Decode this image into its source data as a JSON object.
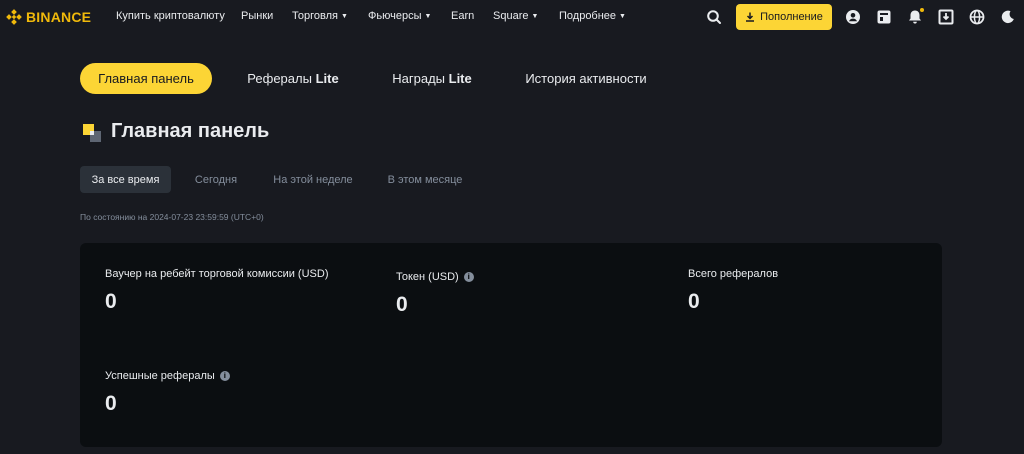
{
  "header": {
    "logo_text": "BINANCE",
    "nav": [
      {
        "label": "Купить криптовалюту",
        "dropdown": false
      },
      {
        "label": "Рынки",
        "dropdown": false
      },
      {
        "label": "Торговля",
        "dropdown": true
      },
      {
        "label": "Фьючерсы",
        "dropdown": true
      },
      {
        "label": "Earn",
        "dropdown": false
      },
      {
        "label": "Square",
        "dropdown": true
      },
      {
        "label": "Подробнее",
        "dropdown": true
      }
    ],
    "deposit_label": "Пополнение",
    "icons": [
      "search-icon",
      "user-icon",
      "orders-icon",
      "bell-icon",
      "download-icon",
      "globe-icon",
      "moon-icon"
    ],
    "accent": "#fcd535"
  },
  "tabs": [
    {
      "label": "Главная панель",
      "suffix": "",
      "active": true
    },
    {
      "label": "Рефералы",
      "suffix": "Lite",
      "active": false
    },
    {
      "label": "Награды",
      "suffix": "Lite",
      "active": false
    },
    {
      "label": "История активности",
      "suffix": "",
      "active": false
    }
  ],
  "page_title": "Главная панель",
  "periods": [
    {
      "label": "За все время",
      "active": true
    },
    {
      "label": "Сегодня",
      "active": false
    },
    {
      "label": "На этой неделе",
      "active": false
    },
    {
      "label": "В этом месяце",
      "active": false
    }
  ],
  "as_of": "По состоянию на 2024-07-23 23:59:59 (UTC+0)",
  "stats": [
    {
      "label": "Ваучер на ребейт торговой комиссии (USD)",
      "value": "0",
      "info": false
    },
    {
      "label": "Токен (USD)",
      "value": "0",
      "info": true
    },
    {
      "label": "Всего рефералов",
      "value": "0",
      "info": false
    },
    {
      "label": "Успешные рефералы",
      "value": "0",
      "info": true
    }
  ]
}
